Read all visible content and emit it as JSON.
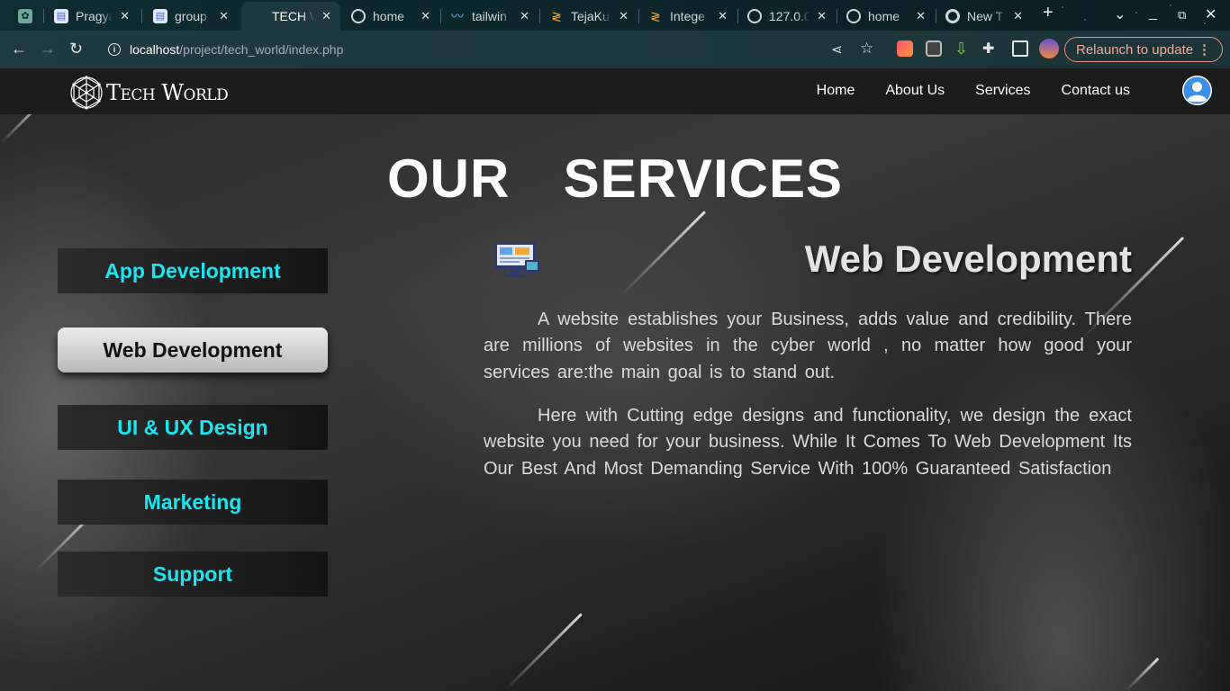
{
  "browser": {
    "tabs": [
      {
        "title": "",
        "icon": "chatgpt-icon"
      },
      {
        "title": "Pragya",
        "icon": "document-icon"
      },
      {
        "title": "group",
        "icon": "document-icon"
      },
      {
        "title": "TECH W",
        "icon": "",
        "active": true
      },
      {
        "title": "home",
        "icon": "globe-icon"
      },
      {
        "title": "tailwin",
        "icon": "tailwind-icon"
      },
      {
        "title": "TejaKu",
        "icon": "code-icon"
      },
      {
        "title": "Intege",
        "icon": "code-icon"
      },
      {
        "title": "127.0.0",
        "icon": "globe-icon"
      },
      {
        "title": "home",
        "icon": "globe-icon"
      },
      {
        "title": "New T",
        "icon": "chrome-icon"
      }
    ],
    "url_host": "localhost",
    "url_path": "/project/tech_world/index.php",
    "relaunch_label": "Relaunch to update"
  },
  "site": {
    "logo_text": "Tech World",
    "nav": [
      "Home",
      "About Us",
      "Services",
      "Contact us"
    ]
  },
  "services": {
    "heading": "OUR  SERVICES",
    "buttons": [
      "App Development",
      "Web Development",
      "UI & UX Design",
      "Marketing",
      "Support"
    ],
    "active_index": 1,
    "active_title": "Web Development",
    "paragraphs": [
      "A website establishes your Business, adds value and credibility. There are millions of websites in the cyber world , no matter how good your services are:the main goal is to stand out.",
      "Here with Cutting edge designs and functionality, we design the exact website you need for your business. While It Comes To Web Development Its Our Best And Most Demanding Service With 100% Guaranteed Satisfaction"
    ]
  },
  "colors": {
    "accent_cyan": "#18e6f0",
    "relaunch": "#f08a7e"
  }
}
